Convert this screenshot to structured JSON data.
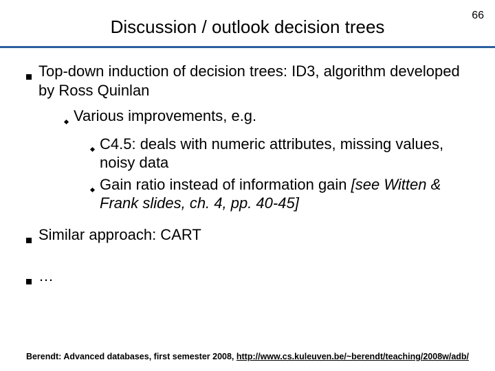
{
  "page_number": "66",
  "title": "Discussion / outlook decision trees",
  "bullets": {
    "b1": "Top-down induction of decision trees: ID3, algorithm developed by Ross Quinlan",
    "b1_1": "Various improvements, e.g.",
    "b1_1_1": "C4.5: deals with numeric attributes, missing values, noisy data",
    "b1_1_2a": "Gain ratio instead of information gain ",
    "b1_1_2b": "[see Witten & Frank slides, ch. 4, pp. 40-45]",
    "b2": "Similar approach: CART",
    "b3": "…"
  },
  "footer": {
    "prefix": "Berendt: Advanced databases, first semester 2008, ",
    "link": "http://www.cs.kuleuven.be/~berendt/teaching/2008w/adb/"
  }
}
